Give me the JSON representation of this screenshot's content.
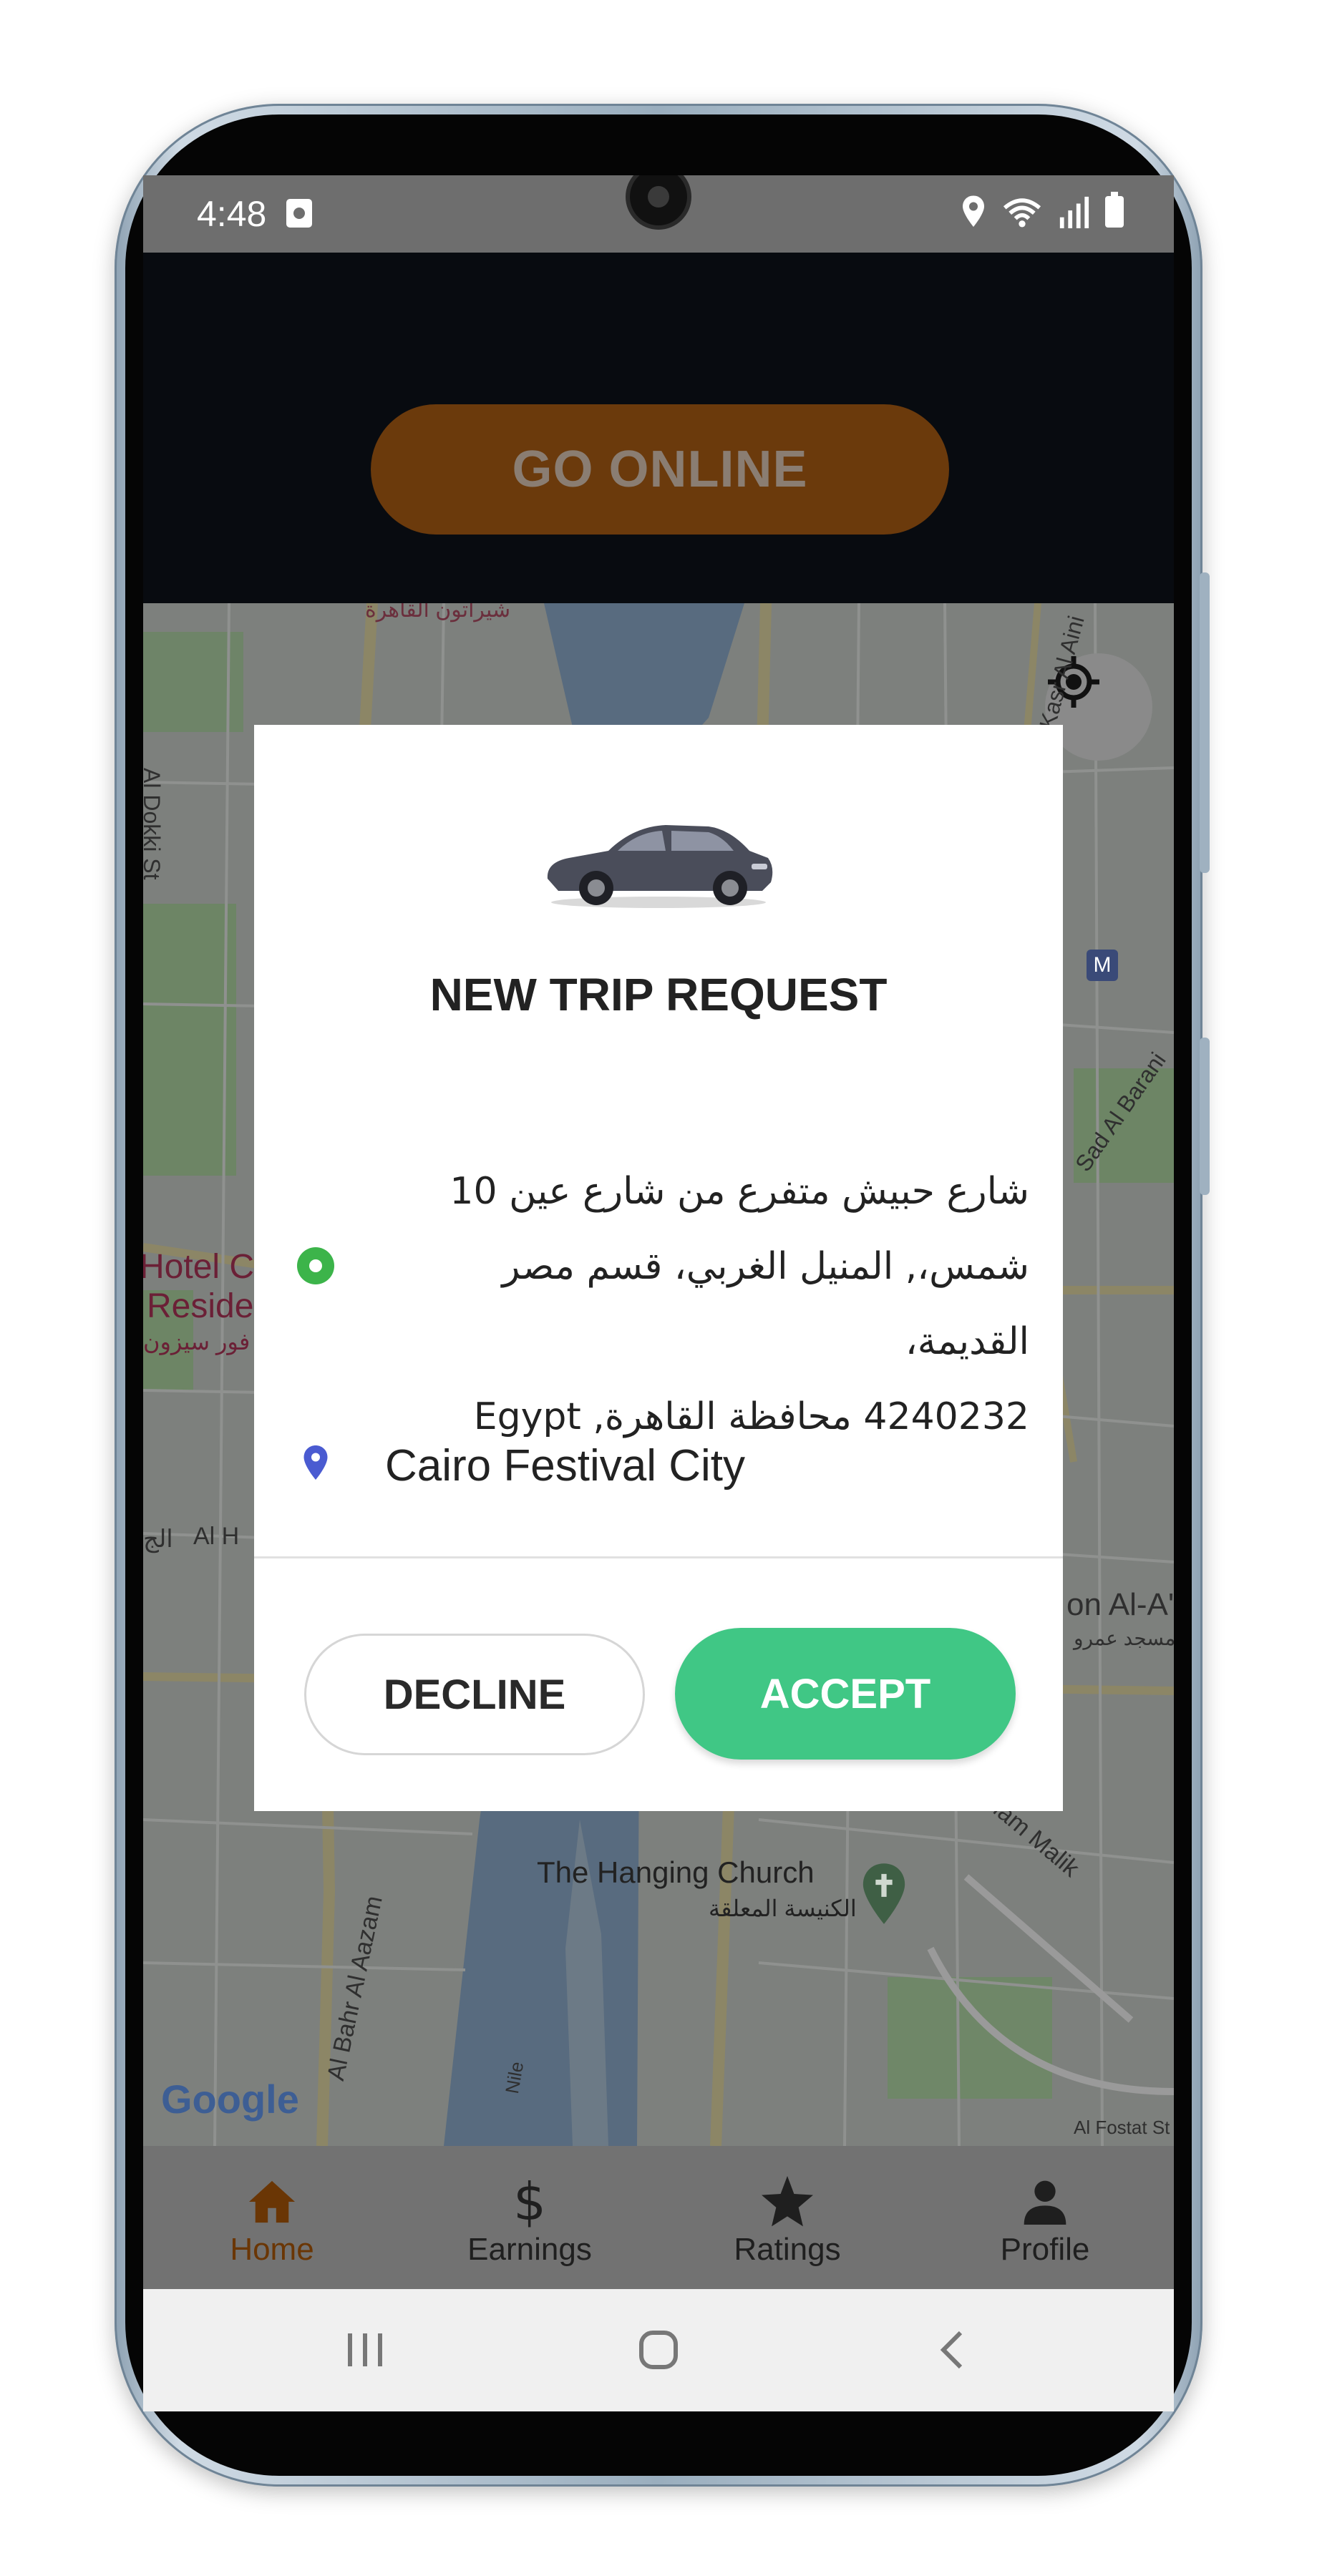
{
  "status_bar": {
    "time": "4:48",
    "icons": [
      "location-icon",
      "wifi-icon",
      "signal-icon",
      "battery-icon"
    ]
  },
  "header": {
    "go_online_label": "GO ONLINE",
    "button_color": "#6b3a0c"
  },
  "map": {
    "labels": {
      "sheraton": "شيراتون القاهرة",
      "dokki": "Al Dokki St",
      "hotel_line1": "Hotel Ca",
      "hotel_line2": "Residen",
      "four_seasons": "فور سيزون",
      "kasr_al_aini": "Kasr Al Aini",
      "saad": "Sad Al Barani",
      "al_h": "Al H",
      "arabic_al_j": "الج",
      "mosque_en": "on Al-A'a",
      "mosque_ar": "مسجد عمرو",
      "hanging_church_en": "The Hanging Church",
      "hanging_church_ar": "الكنيسة المعلقة",
      "imam_malik": "El-Imam Malik",
      "bahr_azam": "Al Bahr Al Aazam",
      "nile": "Nile",
      "fostat": "Al Fostat St",
      "metro": "M"
    },
    "google_logo": "Google"
  },
  "dialog": {
    "title": "NEW TRIP REQUEST",
    "pickup_address": "شارع حبيش متفرع من شارع عين 10 شمس،, المنيل الغربي، قسم مصر القديمة، 4240232 ,محافظة القاهرة Egypt",
    "pickup_line1": "شارع حبيش متفرع من شارع عين  10",
    "pickup_line2": "شمس،, المنيل الغربي، قسم مصر القديمة،",
    "pickup_line3": "4240232 محافظة القاهرة, Egypt",
    "dropoff_address": "Cairo Festival City",
    "decline_label": "DECLINE",
    "accept_label": "ACCEPT",
    "accept_color": "#40c785",
    "pickup_color": "#3cb44a",
    "dropoff_color": "#4a5bd1"
  },
  "tabs": [
    {
      "label": "Home",
      "icon": "home-icon",
      "active": true
    },
    {
      "label": "Earnings",
      "icon": "dollar-icon",
      "active": false
    },
    {
      "label": "Ratings",
      "icon": "star-icon",
      "active": false
    },
    {
      "label": "Profile",
      "icon": "person-icon",
      "active": false
    }
  ],
  "system_nav": {
    "buttons": [
      "recent-apps-icon",
      "home-circle-icon",
      "back-icon"
    ]
  }
}
